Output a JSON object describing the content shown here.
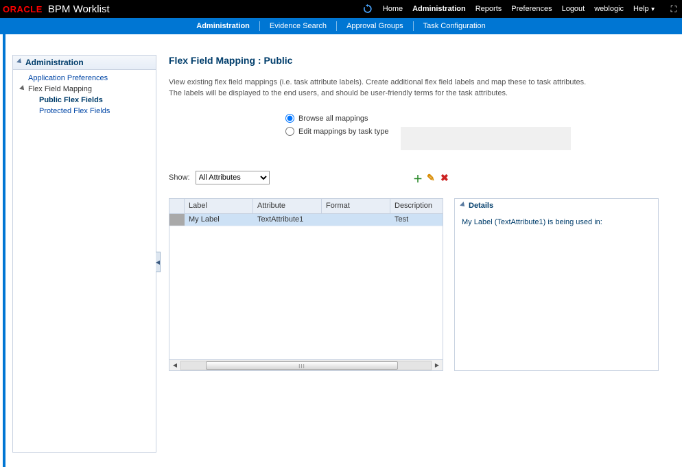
{
  "topbar": {
    "logo": "ORACLE",
    "app_title": "BPM Worklist",
    "links": {
      "home": "Home",
      "administration": "Administration",
      "reports": "Reports",
      "preferences": "Preferences",
      "logout": "Logout",
      "user": "weblogic",
      "help": "Help"
    }
  },
  "bluebar": {
    "administration": "Administration",
    "evidence": "Evidence Search",
    "approval": "Approval Groups",
    "taskconf": "Task Configuration"
  },
  "sidebar": {
    "header": "Administration",
    "app_prefs": "Application Preferences",
    "flex_mapping": "Flex Field Mapping",
    "public_flex": "Public Flex Fields",
    "protected_flex": "Protected Flex Fields"
  },
  "main": {
    "title": "Flex Field Mapping : Public",
    "desc1": "View existing flex field mappings (i.e. task attribute labels). Create additional flex field labels and map these to task attributes.",
    "desc2": "The labels will be displayed to the end users, and should be user-friendly terms for the task attributes.",
    "radio": {
      "browse": "Browse all mappings",
      "edit": "Edit mappings by task type"
    },
    "show_label": "Show:",
    "show_value": "All Attributes",
    "grid": {
      "headers": {
        "label": "Label",
        "attribute": "Attribute",
        "format": "Format",
        "description": "Description"
      },
      "rows": [
        {
          "label": "My Label",
          "attribute": "TextAttribute1",
          "format": "",
          "description": "Test"
        }
      ]
    },
    "details": {
      "header": "Details",
      "text": "My Label (TextAttribute1) is being used in:"
    }
  }
}
